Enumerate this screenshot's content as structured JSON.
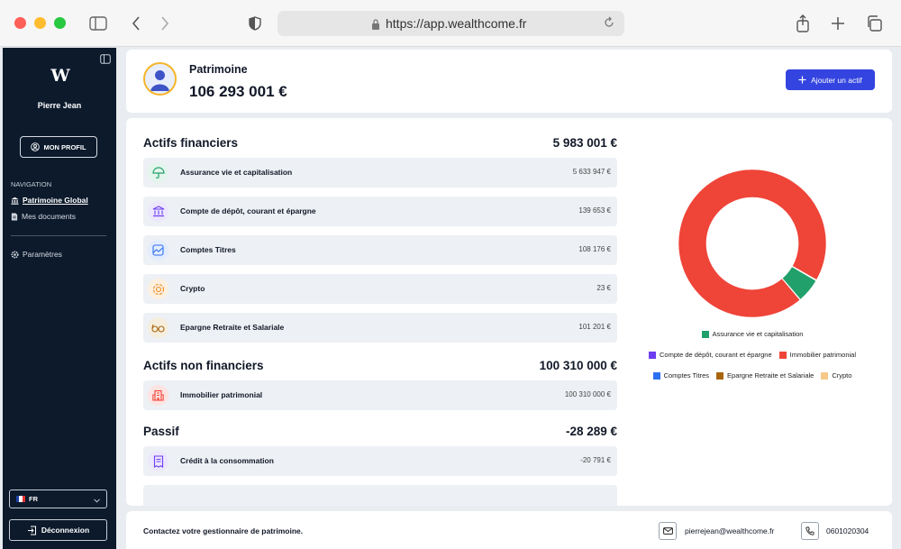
{
  "browser": {
    "url": "https://app.wealthcome.fr"
  },
  "sidebar": {
    "logo_text": "W",
    "user_name": "Pierre Jean",
    "profile_button": "MON PROFIL",
    "nav_title": "NAVIGATION",
    "nav_items": [
      {
        "label": "Patrimoine Global",
        "active": true,
        "icon": "bank-icon"
      },
      {
        "label": "Mes documents",
        "active": false,
        "icon": "document-icon"
      }
    ],
    "settings_label": "Paramètres",
    "language": "FR",
    "logout_label": "Déconnexion"
  },
  "header": {
    "title": "Patrimoine",
    "total": "106 293 001 €",
    "add_button": "Ajouter un actif"
  },
  "sections": {
    "financial": {
      "title": "Actifs financiers",
      "total": "5 983 001 €",
      "rows": [
        {
          "label": "Assurance vie et capitalisation",
          "value": "5 633 947 €",
          "icon": "umbrella-icon"
        },
        {
          "label": "Compte de dépôt, courant et épargne",
          "value": "139 653 €",
          "icon": "bank-icon"
        },
        {
          "label": "Comptes Titres",
          "value": "108 176 €",
          "icon": "chart-icon"
        },
        {
          "label": "Crypto",
          "value": "23 €",
          "icon": "crypto-icon"
        },
        {
          "label": "Epargne Retraite et Salariale",
          "value": "101 201 €",
          "icon": "glasses-icon"
        }
      ]
    },
    "non_financial": {
      "title": "Actifs non financiers",
      "total": "100 310 000 €",
      "rows": [
        {
          "label": "Immobilier patrimonial",
          "value": "100 310 000 €",
          "icon": "building-icon"
        }
      ]
    },
    "liabilities": {
      "title": "Passif",
      "total": "-28 289 €",
      "rows": [
        {
          "label": "Crédit à la consommation",
          "value": "-20 791 €",
          "icon": "receipt-icon"
        }
      ]
    }
  },
  "chart_data": {
    "type": "pie",
    "categories": [
      "Assurance vie et capitalisation",
      "Compte de dépôt, courant et épargne",
      "Immobilier patrimonial",
      "Comptes Titres",
      "Epargne Retraite et Salariale",
      "Crypto"
    ],
    "values": [
      5633947,
      139653,
      100310000,
      108176,
      101201,
      23
    ],
    "colors": [
      "#22a06b",
      "#6d3df0",
      "#ef4438",
      "#2d6ff2",
      "#a8650e",
      "#f6c98a"
    ],
    "legend_placement": "bottom"
  },
  "footer": {
    "text": "Contactez votre gestionnaire de patrimoine.",
    "email": "pierrejean@wealthcome.fr",
    "phone": "0601020304"
  }
}
